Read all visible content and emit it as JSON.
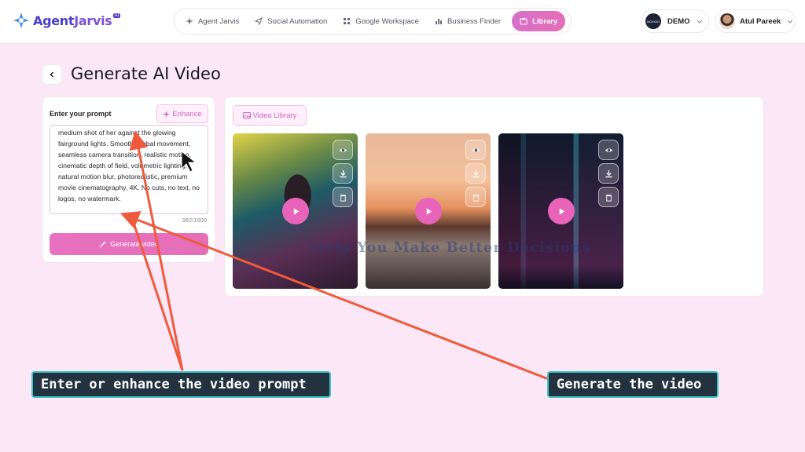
{
  "brand": {
    "name_part1": "Agent",
    "name_part2": "Jarvis",
    "badge": "AI"
  },
  "nav": {
    "items": [
      {
        "label": "Agent Jarvis",
        "icon": "sparkle-icon"
      },
      {
        "label": "Social Automation",
        "icon": "send-icon"
      },
      {
        "label": "Google Workspace",
        "icon": "grid-icon"
      },
      {
        "label": "Business Finder",
        "icon": "bar-chart-icon"
      },
      {
        "label": "Library",
        "icon": "library-icon",
        "active": true
      }
    ]
  },
  "workspace": {
    "label": "DEMO",
    "logo_text": "NOXIOU"
  },
  "user": {
    "name": "Atul Pareek"
  },
  "page": {
    "title": "Generate AI Video"
  },
  "prompt": {
    "label": "Enter your prompt",
    "enhance_label": "Enhance",
    "text": "medium shot of her against the glowing fairground lights. Smooth gimbal movement, seamless camera transition, realistic motion, cinematic depth of field, volumetric lighting, natural motion blur, photorealistic, premium movie cinematography, 4K. No cuts, no text, no logos, no watermark.",
    "char_count": "982/1000",
    "generate_label": "Generate video"
  },
  "library": {
    "button_label": "Video Library",
    "videos": [
      {
        "name": "video-1"
      },
      {
        "name": "video-2"
      },
      {
        "name": "video-3"
      }
    ]
  },
  "overlay": {
    "watermark": "Help You Make Better Decisions",
    "callout_left": "Enter or enhance the video prompt",
    "callout_right": "Generate the video",
    "arrow_color": "#ef5a3c",
    "callout_border": "#3ec3c9"
  }
}
